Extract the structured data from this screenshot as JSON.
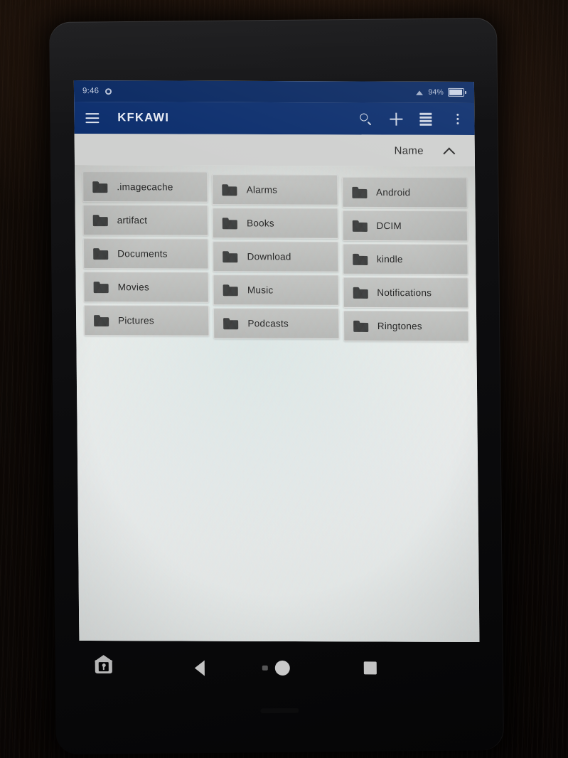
{
  "device": {
    "type": "tablet",
    "orientation": "portrait"
  },
  "status_bar": {
    "time": "9:46",
    "settings_icon": "gear-icon",
    "wifi_icon": "wifi-icon",
    "battery_percent": "94%",
    "battery_icon": "battery-icon"
  },
  "app_bar": {
    "menu_icon": "hamburger-menu-icon",
    "title": "KFKAWI",
    "actions": [
      {
        "name": "search",
        "icon": "search-icon"
      },
      {
        "name": "add",
        "icon": "plus-icon"
      },
      {
        "name": "view-mode",
        "icon": "list-view-icon"
      },
      {
        "name": "more-options",
        "icon": "overflow-menu-icon"
      }
    ],
    "background_color": "#0d2f6e"
  },
  "sort_bar": {
    "label": "Name",
    "direction_icon": "chevron-up-icon",
    "direction": "ascending"
  },
  "file_grid": {
    "columns": 3,
    "items": [
      {
        "name": ".imagecache",
        "type": "folder"
      },
      {
        "name": "Alarms",
        "type": "folder"
      },
      {
        "name": "Android",
        "type": "folder"
      },
      {
        "name": "artifact",
        "type": "folder"
      },
      {
        "name": "Books",
        "type": "folder"
      },
      {
        "name": "DCIM",
        "type": "folder"
      },
      {
        "name": "Documents",
        "type": "folder"
      },
      {
        "name": "Download",
        "type": "folder"
      },
      {
        "name": "kindle",
        "type": "folder"
      },
      {
        "name": "Movies",
        "type": "folder"
      },
      {
        "name": "Music",
        "type": "folder"
      },
      {
        "name": "Notifications",
        "type": "folder"
      },
      {
        "name": "Pictures",
        "type": "folder"
      },
      {
        "name": "Podcasts",
        "type": "folder"
      },
      {
        "name": "Ringtones",
        "type": "folder"
      }
    ]
  },
  "navigation_bar": {
    "buttons": [
      {
        "name": "home-shortcut",
        "icon": "house-icon"
      },
      {
        "name": "back",
        "icon": "back-triangle-icon"
      },
      {
        "name": "home",
        "icon": "home-circle-icon"
      },
      {
        "name": "recents",
        "icon": "recents-square-icon"
      }
    ]
  }
}
